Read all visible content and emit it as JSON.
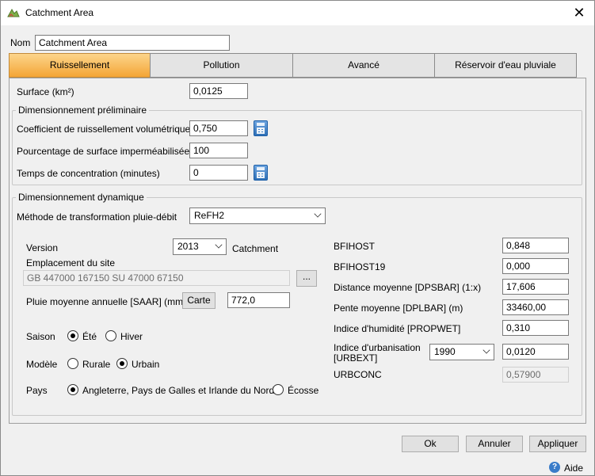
{
  "window": {
    "title": "Catchment Area",
    "icon": "catchment-icon",
    "close": "✕"
  },
  "name": {
    "label": "Nom",
    "value": "Catchment Area"
  },
  "tabs": [
    {
      "label": "Ruissellement",
      "active": true
    },
    {
      "label": "Pollution",
      "active": false
    },
    {
      "label": "Avancé",
      "active": false
    },
    {
      "label": "Réservoir d'eau pluviale",
      "active": false
    }
  ],
  "surface": {
    "label": "Surface (km²)",
    "value": "0,0125"
  },
  "prelim": {
    "title": "Dimensionnement préliminaire",
    "coef_label": "Coefficient de ruissellement volumétrique",
    "coef_value": "0,750",
    "pct_label": "Pourcentage de surface imperméabilisée (%)",
    "pct_value": "100",
    "temps_label": "Temps de concentration (minutes)",
    "temps_value": "0"
  },
  "dyn": {
    "title": "Dimensionnement dynamique",
    "method_label": "Méthode de transformation pluie-débit",
    "method_value": "ReFH2",
    "version_label": "Version",
    "version_value": "2013",
    "catchment_label": "Catchment",
    "site_label": "Emplacement du site",
    "site_value": "GB 447000 167150 SU 47000 67150",
    "browse": "...",
    "saar_label": "Pluie moyenne annuelle [SAAR] (mm)",
    "carte": "Carte",
    "saar_value": "772,0",
    "saison_label": "Saison",
    "ete": "Été",
    "hiver": "Hiver",
    "modele_label": "Modèle",
    "rurale": "Rurale",
    "urbain": "Urbain",
    "pays_label": "Pays",
    "pays_a": "Angleterre, Pays de Galles et Irlande du Nord",
    "pays_b": "Écosse",
    "bfihost_label": "BFIHOST",
    "bfihost_value": "0,848",
    "bfihost19_label": "BFIHOST19",
    "bfihost19_value": "0,000",
    "dpsbar_label": "Distance moyenne [DPSBAR] (1:x)",
    "dpsbar_value": "17,606",
    "dplbar_label": "Pente moyenne [DPLBAR] (m)",
    "dplbar_value": "33460,00",
    "propwet_label": "Indice d'humidité [PROPWET]",
    "propwet_value": "0,310",
    "urbext_label_1": "Indice d'urbanisation",
    "urbext_label_2": "[URBEXT]",
    "urbext_year": "1990",
    "urbext_value": "0,0120",
    "urbconc_label": "URBCONC",
    "urbconc_value": "0,57900"
  },
  "footer": {
    "ok": "Ok",
    "annuler": "Annuler",
    "appliquer": "Appliquer",
    "aide": "Aide"
  }
}
